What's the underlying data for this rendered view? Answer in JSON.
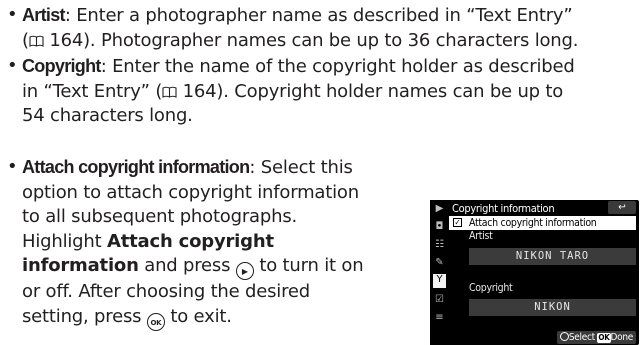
{
  "bullet_char": "•",
  "book_ref": "164",
  "artist": {
    "term": "Artist",
    "l1": ": Enter a photographer name as described in “Text Entry”",
    "l2a": "(",
    "l2b": " 164). Photographer names can be up to 36 characters long."
  },
  "copyright": {
    "term": "Copyright",
    "l1": ": Enter the name of the copyright holder as described",
    "l2a": "in “Text Entry” (",
    "l2b": " 164). Copyright holder names can be up to",
    "l3": "54 characters long."
  },
  "attach": {
    "term": "Attach copyright information",
    "l1": ": Select this",
    "l2": "option to attach copyright information",
    "l3": "to all subsequent photographs.",
    "l4a": "Highlight ",
    "l4b": "Attach copyright",
    "l5a": "information",
    "l5b": " and press ",
    "l5c": " to turn it on",
    "l6": "or off. After choosing the desired",
    "l7a": "setting, press ",
    "l7b": " to exit.",
    "multi_selector_glyph": "▶",
    "ok_glyph": "OK"
  },
  "camera": {
    "title": "Copyright information",
    "back": "↩",
    "checkbox_mark": "✓",
    "row_attach": "Attach copyright information",
    "label_artist": "Artist",
    "value_artist": "NIKON TARO",
    "label_copyright": "Copyright",
    "value_copyright": "NIKON",
    "footer_select": "Select",
    "footer_ok": "OK",
    "footer_done": "Done",
    "side_icons": [
      "▶",
      "◘",
      "☷",
      "✎",
      "Y",
      "☑",
      "≡"
    ]
  }
}
